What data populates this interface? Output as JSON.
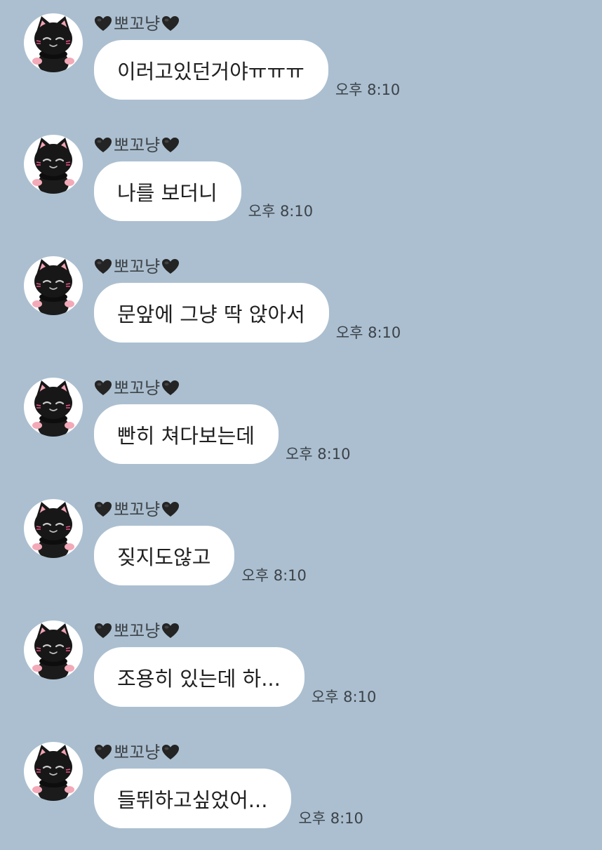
{
  "conversation": {
    "background": "#abbfd0",
    "bubble_color": "#ffffff",
    "messages": [
      {
        "sender": "뽀꼬냥",
        "text": "이러고있던거야ㅠㅠㅠ",
        "time": "오후 8:10"
      },
      {
        "sender": "뽀꼬냥",
        "text": "나를 보더니",
        "time": "오후 8:10"
      },
      {
        "sender": "뽀꼬냥",
        "text": "문앞에 그냥 딱 앉아서",
        "time": "오후 8:10"
      },
      {
        "sender": "뽀꼬냥",
        "text": "빤히 쳐다보는데",
        "time": "오후 8:10"
      },
      {
        "sender": "뽀꼬냥",
        "text": "짖지도않고",
        "time": "오후 8:10"
      },
      {
        "sender": "뽀꼬냥",
        "text": "조용히 있는데 하...",
        "time": "오후 8:10"
      },
      {
        "sender": "뽀꼬냥",
        "text": "들뛰하고싶었어...",
        "time": "오후 8:10"
      }
    ]
  },
  "icons": {
    "avatar": "black-cat-avatar-icon",
    "sender_decoration": "black-heart-icon"
  }
}
